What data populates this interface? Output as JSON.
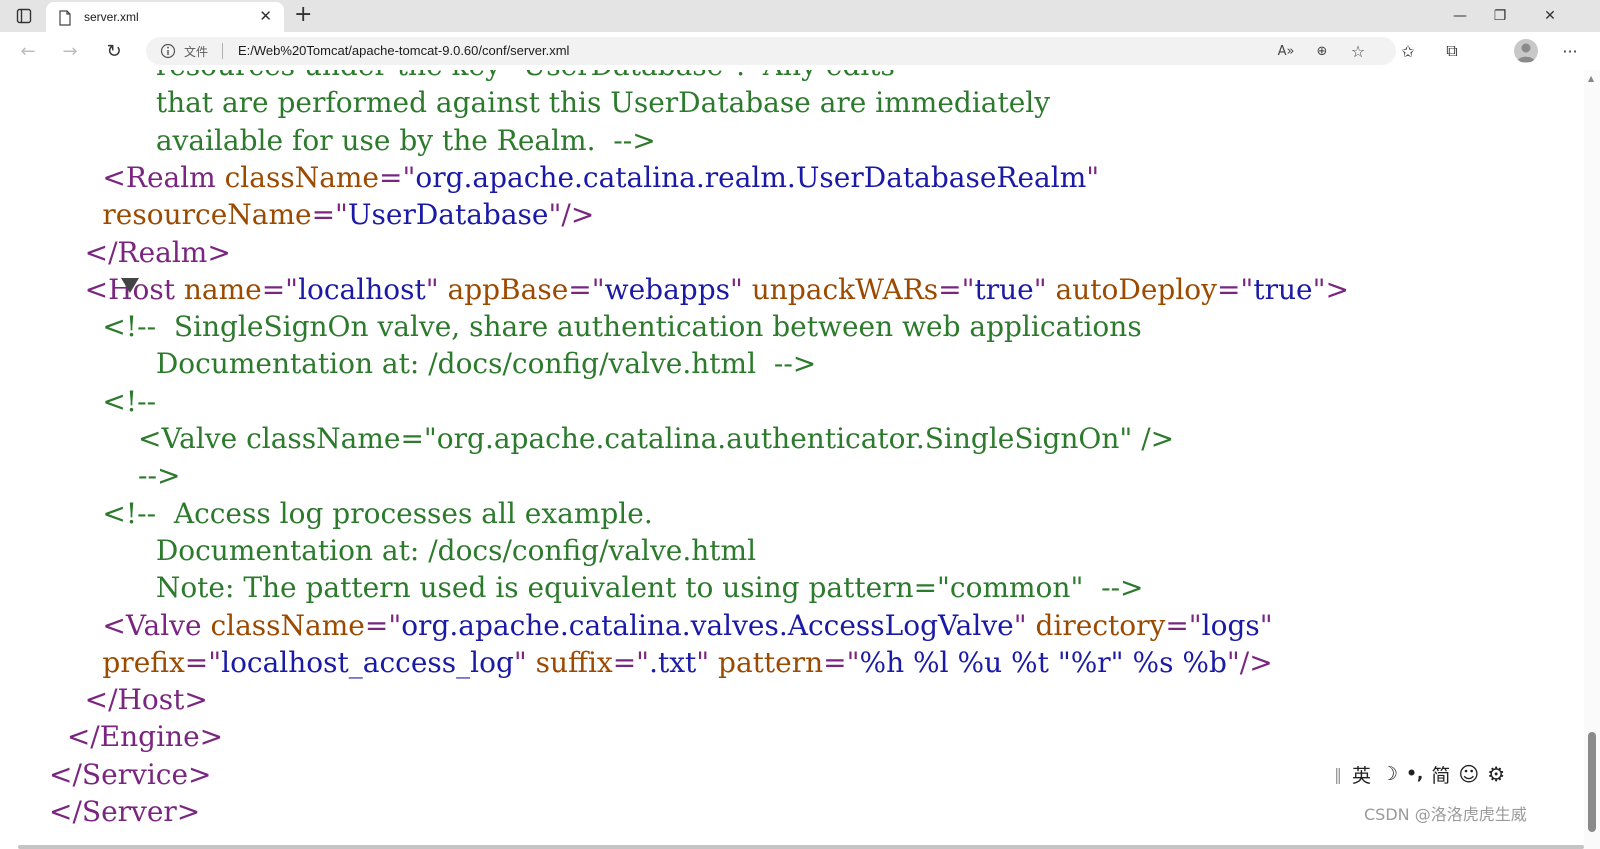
{
  "browser": {
    "tab_title": "server.xml",
    "tab_close": "✕",
    "new_tab": "+",
    "window_controls": {
      "minimize": "—",
      "restore": "❐",
      "close": "✕"
    },
    "nav": {
      "back": "←",
      "forward": "→",
      "refresh": "↻"
    },
    "address": {
      "scheme_label": "文件",
      "url": "E:/Web%20Tomcat/apache-tomcat-9.0.60/conf/server.xml"
    },
    "address_icons": {
      "read_aloud": "A»",
      "zoom": "⊕",
      "add_favorite": "☆"
    },
    "toolbar_icons": {
      "favorites": "✩",
      "collections": "⧉",
      "more": "···"
    }
  },
  "xml_lines": [
    {
      "indent": "            ",
      "segments": [
        {
          "t": "resources under the key \"UserDatabase\".  Any edits",
          "c": "cm"
        }
      ]
    },
    {
      "indent": "            ",
      "segments": [
        {
          "t": "that are performed against this UserDatabase are immediately",
          "c": "cm"
        }
      ]
    },
    {
      "indent": "            ",
      "segments": [
        {
          "t": "available for use by the Realm.  -->",
          "c": "cm"
        }
      ]
    },
    {
      "indent": "      ",
      "segments": [
        {
          "t": "<Realm",
          "c": "tg"
        },
        {
          "t": " className",
          "c": "at"
        },
        {
          "t": "=\"",
          "c": "tg"
        },
        {
          "t": "org.apache.catalina.realm.UserDatabaseRealm",
          "c": "vl"
        },
        {
          "t": "\"",
          "c": "tg"
        }
      ]
    },
    {
      "indent": "      ",
      "segments": [
        {
          "t": "resourceName",
          "c": "at"
        },
        {
          "t": "=\"",
          "c": "tg"
        },
        {
          "t": "UserDatabase",
          "c": "vl"
        },
        {
          "t": "\"/>",
          "c": "tg"
        }
      ]
    },
    {
      "indent": "    ",
      "segments": [
        {
          "t": "</Realm>",
          "c": "tg"
        }
      ]
    },
    {
      "indent": "    ",
      "segments": [
        {
          "t": "<Host",
          "c": "tg"
        },
        {
          "t": " name",
          "c": "at"
        },
        {
          "t": "=\"",
          "c": "tg"
        },
        {
          "t": "localhost",
          "c": "vl"
        },
        {
          "t": "\"",
          "c": "tg"
        },
        {
          "t": " appBase",
          "c": "at"
        },
        {
          "t": "=\"",
          "c": "tg"
        },
        {
          "t": "webapps",
          "c": "vl"
        },
        {
          "t": "\"",
          "c": "tg"
        },
        {
          "t": " unpackWARs",
          "c": "at"
        },
        {
          "t": "=\"",
          "c": "tg"
        },
        {
          "t": "true",
          "c": "vl"
        },
        {
          "t": "\"",
          "c": "tg"
        },
        {
          "t": " autoDeploy",
          "c": "at"
        },
        {
          "t": "=\"",
          "c": "tg"
        },
        {
          "t": "true",
          "c": "vl"
        },
        {
          "t": "\">",
          "c": "tg"
        }
      ]
    },
    {
      "indent": "      ",
      "segments": [
        {
          "t": "<!--  SingleSignOn valve, share authentication between web applications",
          "c": "cm"
        }
      ]
    },
    {
      "indent": "            ",
      "segments": [
        {
          "t": "Documentation at: /docs/config/valve.html  -->",
          "c": "cm"
        }
      ]
    },
    {
      "indent": "      ",
      "segments": [
        {
          "t": "<!--",
          "c": "cm"
        }
      ]
    },
    {
      "indent": "          ",
      "segments": [
        {
          "t": "<Valve className=\"org.apache.catalina.authenticator.SingleSignOn\" />",
          "c": "cm"
        }
      ]
    },
    {
      "indent": "          ",
      "segments": [
        {
          "t": "-->",
          "c": "cm"
        }
      ]
    },
    {
      "indent": "      ",
      "segments": [
        {
          "t": "<!--  Access log processes all example.",
          "c": "cm"
        }
      ]
    },
    {
      "indent": "            ",
      "segments": [
        {
          "t": "Documentation at: /docs/config/valve.html",
          "c": "cm"
        }
      ]
    },
    {
      "indent": "            ",
      "segments": [
        {
          "t": "Note: The pattern used is equivalent to using pattern=\"common\"  -->",
          "c": "cm"
        }
      ]
    },
    {
      "indent": "      ",
      "segments": [
        {
          "t": "<Valve",
          "c": "tg"
        },
        {
          "t": " className",
          "c": "at"
        },
        {
          "t": "=\"",
          "c": "tg"
        },
        {
          "t": "org.apache.catalina.valves.AccessLogValve",
          "c": "vl"
        },
        {
          "t": "\"",
          "c": "tg"
        },
        {
          "t": " directory",
          "c": "at"
        },
        {
          "t": "=\"",
          "c": "tg"
        },
        {
          "t": "logs",
          "c": "vl"
        },
        {
          "t": "\"",
          "c": "tg"
        }
      ]
    },
    {
      "indent": "      ",
      "segments": [
        {
          "t": "prefix",
          "c": "at"
        },
        {
          "t": "=\"",
          "c": "tg"
        },
        {
          "t": "localhost_access_log",
          "c": "vl"
        },
        {
          "t": "\"",
          "c": "tg"
        },
        {
          "t": " suffix",
          "c": "at"
        },
        {
          "t": "=\"",
          "c": "tg"
        },
        {
          "t": ".txt",
          "c": "vl"
        },
        {
          "t": "\"",
          "c": "tg"
        },
        {
          "t": " pattern",
          "c": "at"
        },
        {
          "t": "=\"",
          "c": "tg"
        },
        {
          "t": "%h %l %u %t \"%r\" %s %b",
          "c": "vl"
        },
        {
          "t": "\"/>",
          "c": "tg"
        }
      ]
    },
    {
      "indent": "    ",
      "segments": [
        {
          "t": "</Host>",
          "c": "tg"
        }
      ]
    },
    {
      "indent": "  ",
      "segments": [
        {
          "t": "</Engine>",
          "c": "tg"
        }
      ]
    },
    {
      "indent": "",
      "segments": [
        {
          "t": "</Service>",
          "c": "tg"
        }
      ]
    },
    {
      "indent": "",
      "segments": [
        {
          "t": "</Server>",
          "c": "tg"
        }
      ]
    }
  ],
  "fold_toggle_line": 6,
  "ime": {
    "grip": "‖",
    "lang": "英",
    "moon": "☽",
    "punct": "•,",
    "script": "简",
    "emoji": "☺",
    "settings": "⚙"
  },
  "watermark": "CSDN @洛洛虎虎生威"
}
